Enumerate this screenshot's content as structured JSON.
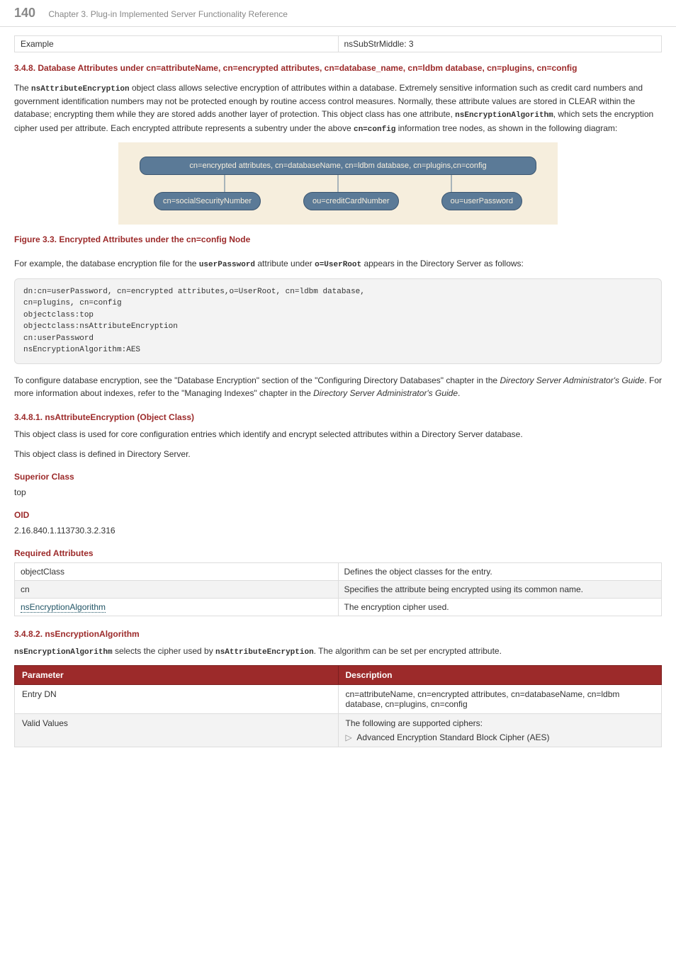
{
  "header": {
    "page_number": "140",
    "chapter": "Chapter 3. Plug-in Implemented Server Functionality Reference"
  },
  "exampleRow": {
    "label": "Example",
    "value": "nsSubStrMiddle: 3"
  },
  "section348": {
    "title": "3.4.8. Database Attributes under cn=attributeName, cn=encrypted attributes, cn=database_name, cn=ldbm database, cn=plugins, cn=config",
    "para1a": "The ",
    "code1": "nsAttributeEncryption",
    "para1b": " object class allows selective encryption of attributes within a database. Extremely sensitive information such as credit card numbers and government identification numbers may not be protected enough by routine access control measures. Normally, these attribute values are stored in CLEAR within the database; encrypting them while they are stored adds another layer of protection. This object class has one attribute, ",
    "code2": "nsEncryptionAlgorithm",
    "para1c": ", which sets the encryption cipher used per attribute. Each encrypted attribute represents a subentry under the above ",
    "code3": "cn=config",
    "para1d": " information tree nodes, as shown in the following diagram:"
  },
  "diagram": {
    "top": "cn=encrypted attributes, cn=databaseName, cn=ldbm database, cn=plugins,cn=config",
    "pill1": "cn=socialSecurityNumber",
    "pill2": "ou=creditCardNumber",
    "pill3": "ou=userPassword"
  },
  "figCaption": "Figure 3.3. Encrypted Attributes under the cn=config Node",
  "examplePara": {
    "a": "For example, the database encryption file for the ",
    "code1": "userPassword",
    "b": " attribute under ",
    "code2": "o=UserRoot",
    "c": " appears in the Directory Server as follows:"
  },
  "codeBlock": "dn:cn=userPassword, cn=encrypted attributes,o=UserRoot, cn=ldbm database,\ncn=plugins, cn=config\nobjectclass:top\nobjectclass:nsAttributeEncryption\ncn:userPassword\nnsEncryptionAlgorithm:AES",
  "configurePara": {
    "a": "To configure database encryption, see the \"Database Encryption\" section of the \"Configuring Directory Databases\" chapter in the ",
    "em1": "Directory Server Administrator's Guide",
    "b": ". For more information about indexes, refer to the \"Managing Indexes\" chapter in the ",
    "em2": "Directory Server Administrator's Guide",
    "c": "."
  },
  "sub3481": {
    "title": "3.4.8.1. nsAttributeEncryption (Object Class)",
    "p1": "This object class is used for core configuration entries which identify and encrypt selected attributes within a Directory Server database.",
    "p2": "This object class is defined in Directory Server."
  },
  "superior": {
    "heading": "Superior Class",
    "value": "top"
  },
  "oid": {
    "heading": "OID",
    "value": "2.16.840.1.113730.3.2.316"
  },
  "reqAttrs": {
    "heading": "Required Attributes",
    "rows": [
      {
        "name": "objectClass",
        "desc": "Defines the object classes for the entry."
      },
      {
        "name": "cn",
        "desc": "Specifies the attribute being encrypted using its common name."
      },
      {
        "name": "nsEncryptionAlgorithm",
        "desc": "The encryption cipher used."
      }
    ]
  },
  "sub3482": {
    "title": "3.4.8.2. nsEncryptionAlgorithm",
    "code1": "nsEncryptionAlgorithm",
    "a": " selects the cipher used by ",
    "code2": "nsAttributeEncryption",
    "b": ". The algorithm can be set per encrypted attribute."
  },
  "paramTable": {
    "h1": "Parameter",
    "h2": "Description",
    "row1": {
      "p": "Entry DN",
      "d": "cn=attributeName, cn=encrypted attributes, cn=databaseName, cn=ldbm database, cn=plugins, cn=config"
    },
    "row2": {
      "p": "Valid Values",
      "d": "The following are supported ciphers:",
      "bullet": "Advanced Encryption Standard Block Cipher (AES)"
    }
  }
}
